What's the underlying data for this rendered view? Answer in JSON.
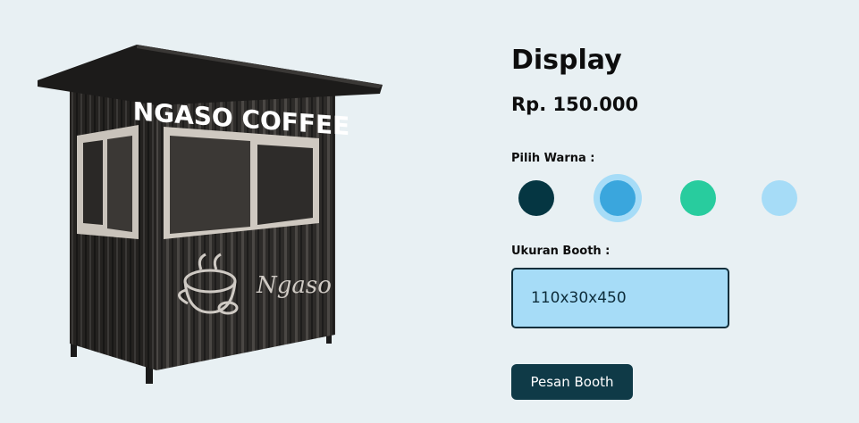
{
  "product": {
    "title": "Display",
    "price": "Rp. 150.000",
    "sign_text": "NGASO COFFEE",
    "logo_script": "Ngaso"
  },
  "color_picker": {
    "label": "Pilih Warna :",
    "options": [
      {
        "name": "dark-teal",
        "hex": "#053642",
        "selected": false
      },
      {
        "name": "blue",
        "hex": "#3aa6dd",
        "selected": true
      },
      {
        "name": "green",
        "hex": "#28cc9e",
        "selected": false
      },
      {
        "name": "light-blue",
        "hex": "#a6dcf7",
        "selected": false
      }
    ]
  },
  "size": {
    "label": "Ukuran Booth :",
    "value": "110x30x450"
  },
  "order_button": {
    "label": "Pesan Booth"
  }
}
